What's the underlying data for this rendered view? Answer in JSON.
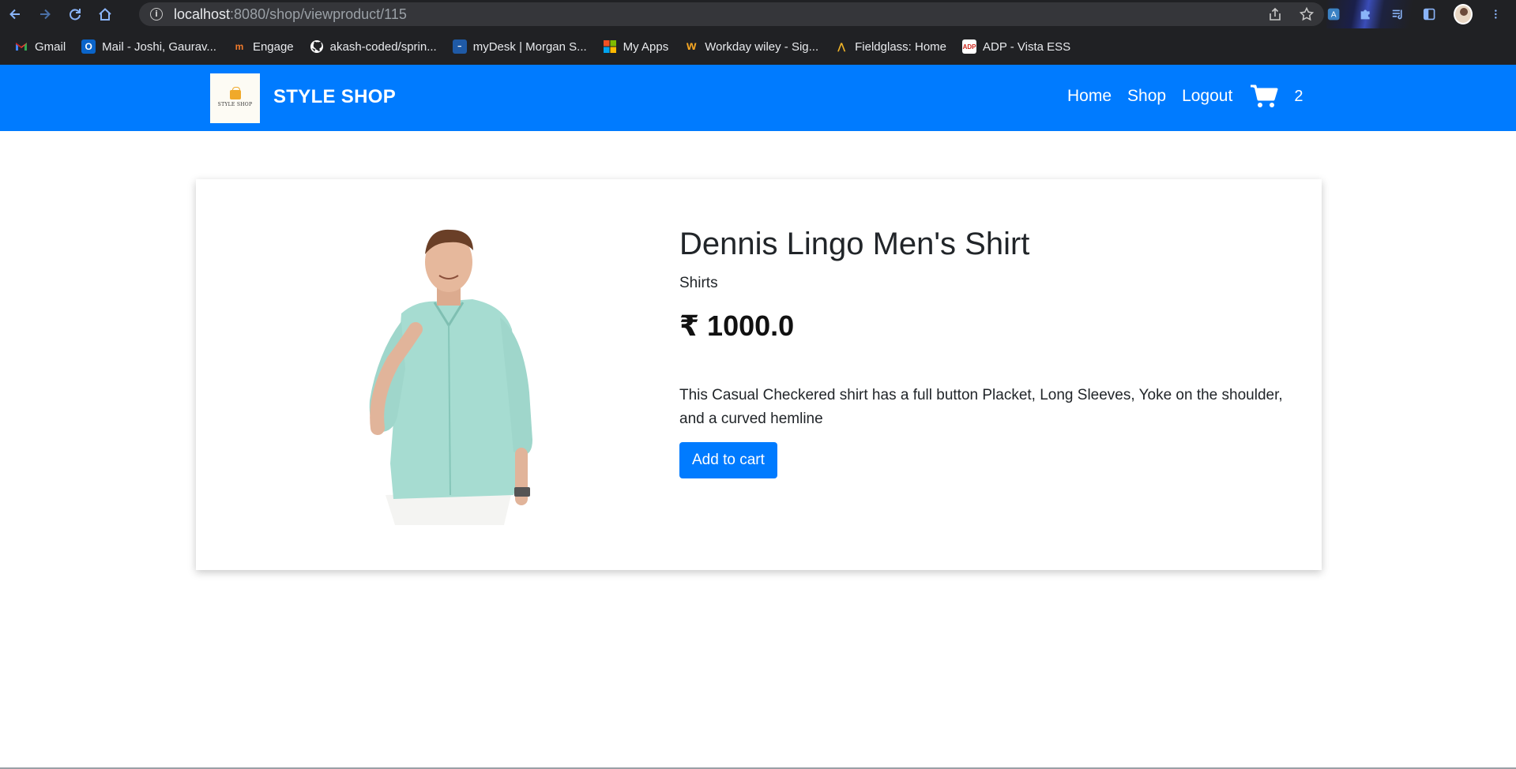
{
  "browser": {
    "url_host": "localhost",
    "url_rest": ":8080/shop/viewproduct/115",
    "bookmarks": [
      {
        "label": "Gmail",
        "icon": "gmail-icon"
      },
      {
        "label": "Mail - Joshi, Gaurav...",
        "icon": "outlook-icon"
      },
      {
        "label": "Engage",
        "icon": "engage-icon"
      },
      {
        "label": "akash-coded/sprin...",
        "icon": "github-icon"
      },
      {
        "label": "myDesk | Morgan S...",
        "icon": "mydesk-icon"
      },
      {
        "label": "My Apps",
        "icon": "microsoft-icon"
      },
      {
        "label": "Workday wiley - Sig...",
        "icon": "workday-icon"
      },
      {
        "label": "Fieldglass: Home",
        "icon": "fieldglass-icon"
      },
      {
        "label": "ADP - Vista ESS",
        "icon": "adp-icon"
      }
    ]
  },
  "navbar": {
    "logo_text": "STYLE SHOP",
    "brand": "STYLE SHOP",
    "links": [
      "Home",
      "Shop",
      "Logout"
    ],
    "cart_count": "2",
    "color": "#007bff"
  },
  "product": {
    "title": "Dennis Lingo Men's Shirt",
    "category": "Shirts",
    "price": "₹ 1000.0",
    "description": "This Casual Checkered shirt has a full button Placket, Long Sleeves, Yoke on the shoulder, and a curved hemline",
    "add_to_cart_label": "Add to cart",
    "image_icon": "product-photo-mint-shirt"
  }
}
